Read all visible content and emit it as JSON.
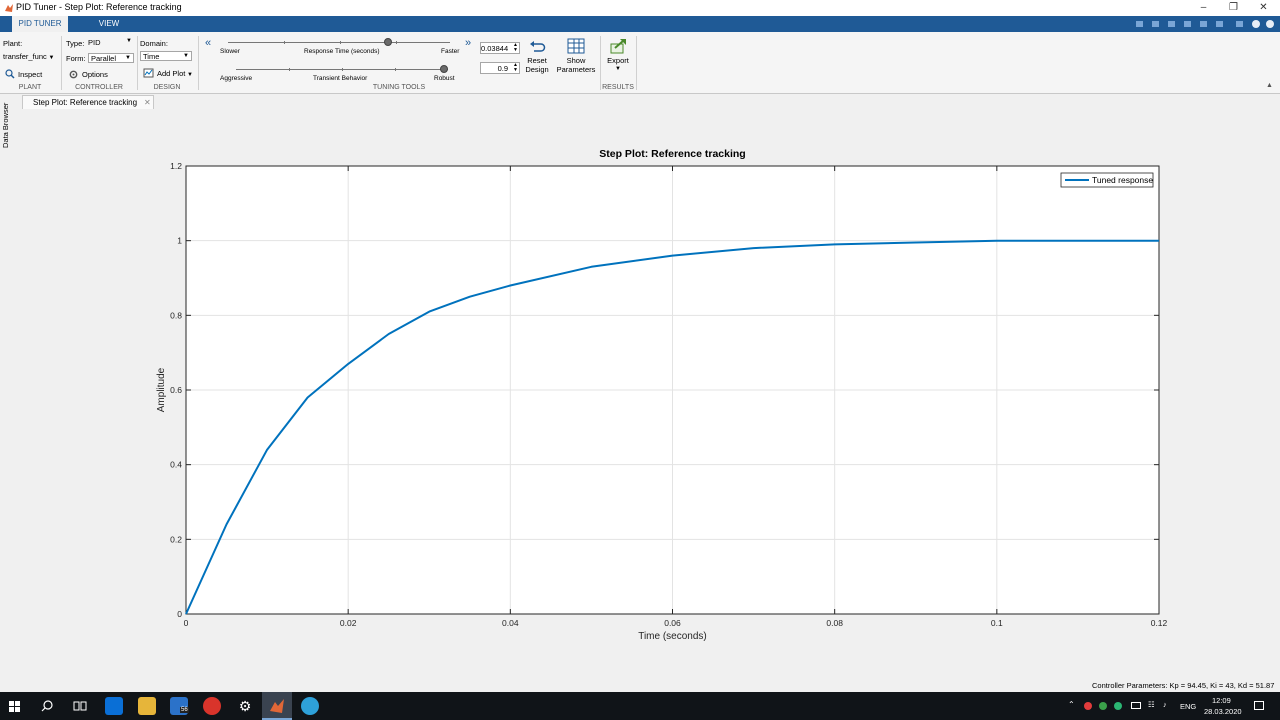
{
  "window": {
    "title": "PID Tuner - Step Plot: Reference tracking"
  },
  "ribbon_tabs": [
    "PID TUNER",
    "VIEW"
  ],
  "plant": {
    "label": "Plant:",
    "value": "transfer_func",
    "inspect": "Inspect",
    "section": "PLANT"
  },
  "controller": {
    "type_label": "Type:",
    "type_value": "PID",
    "form_label": "Form:",
    "form_value": "Parallel",
    "options": "Options",
    "section": "CONTROLLER"
  },
  "design": {
    "domain_label": "Domain:",
    "domain_value": "Time",
    "add_plot": "Add Plot",
    "section": "DESIGN"
  },
  "tuning": {
    "slower": "Slower",
    "response_time": "Response Time (seconds)",
    "faster": "Faster",
    "aggressive": "Aggressive",
    "transient_behavior": "Transient Behavior",
    "robust": "Robust",
    "response_time_value": "0.03844",
    "transient_value": "0.9",
    "response_fraction": 0.72,
    "transient_fraction": 0.98,
    "section": "TUNING TOOLS"
  },
  "buttons": {
    "reset_line1": "Reset",
    "reset_line2": "Design",
    "show_line1": "Show",
    "show_line2": "Parameters",
    "export": "Export",
    "results_section": "RESULTS"
  },
  "doc_tab": "Step Plot: Reference tracking",
  "data_browser": "Data Browser",
  "status": {
    "controller_params": "Controller Parameters: Kp = 94.45, Ki = 43, Kd = 51.87"
  },
  "taskbar": {
    "mail_badge": "56",
    "lang": "ENG",
    "time": "12:09",
    "date": "28.03.2020"
  },
  "colors": {
    "line": "#0072bd",
    "ribbon": "#1f5a96"
  },
  "chart_data": {
    "type": "line",
    "title": "Step Plot: Reference tracking",
    "xlabel": "Time (seconds)",
    "ylabel": "Amplitude",
    "xlim": [
      0,
      0.12
    ],
    "ylim": [
      0,
      1.2
    ],
    "xticks": [
      "0",
      "0.02",
      "0.04",
      "0.06",
      "0.08",
      "0.1",
      "0.12"
    ],
    "yticks": [
      "0",
      "0.2",
      "0.4",
      "0.6",
      "0.8",
      "1",
      "1.2"
    ],
    "grid": true,
    "legend_position": "top-right",
    "series": [
      {
        "name": "Tuned response",
        "x": [
          0,
          0.005,
          0.01,
          0.015,
          0.02,
          0.025,
          0.03,
          0.035,
          0.04,
          0.05,
          0.06,
          0.07,
          0.08,
          0.09,
          0.1,
          0.11,
          0.12
        ],
        "values": [
          0,
          0.24,
          0.44,
          0.58,
          0.67,
          0.75,
          0.81,
          0.85,
          0.88,
          0.93,
          0.96,
          0.98,
          0.99,
          0.995,
          1.0,
          1.0,
          1.0
        ]
      }
    ]
  }
}
